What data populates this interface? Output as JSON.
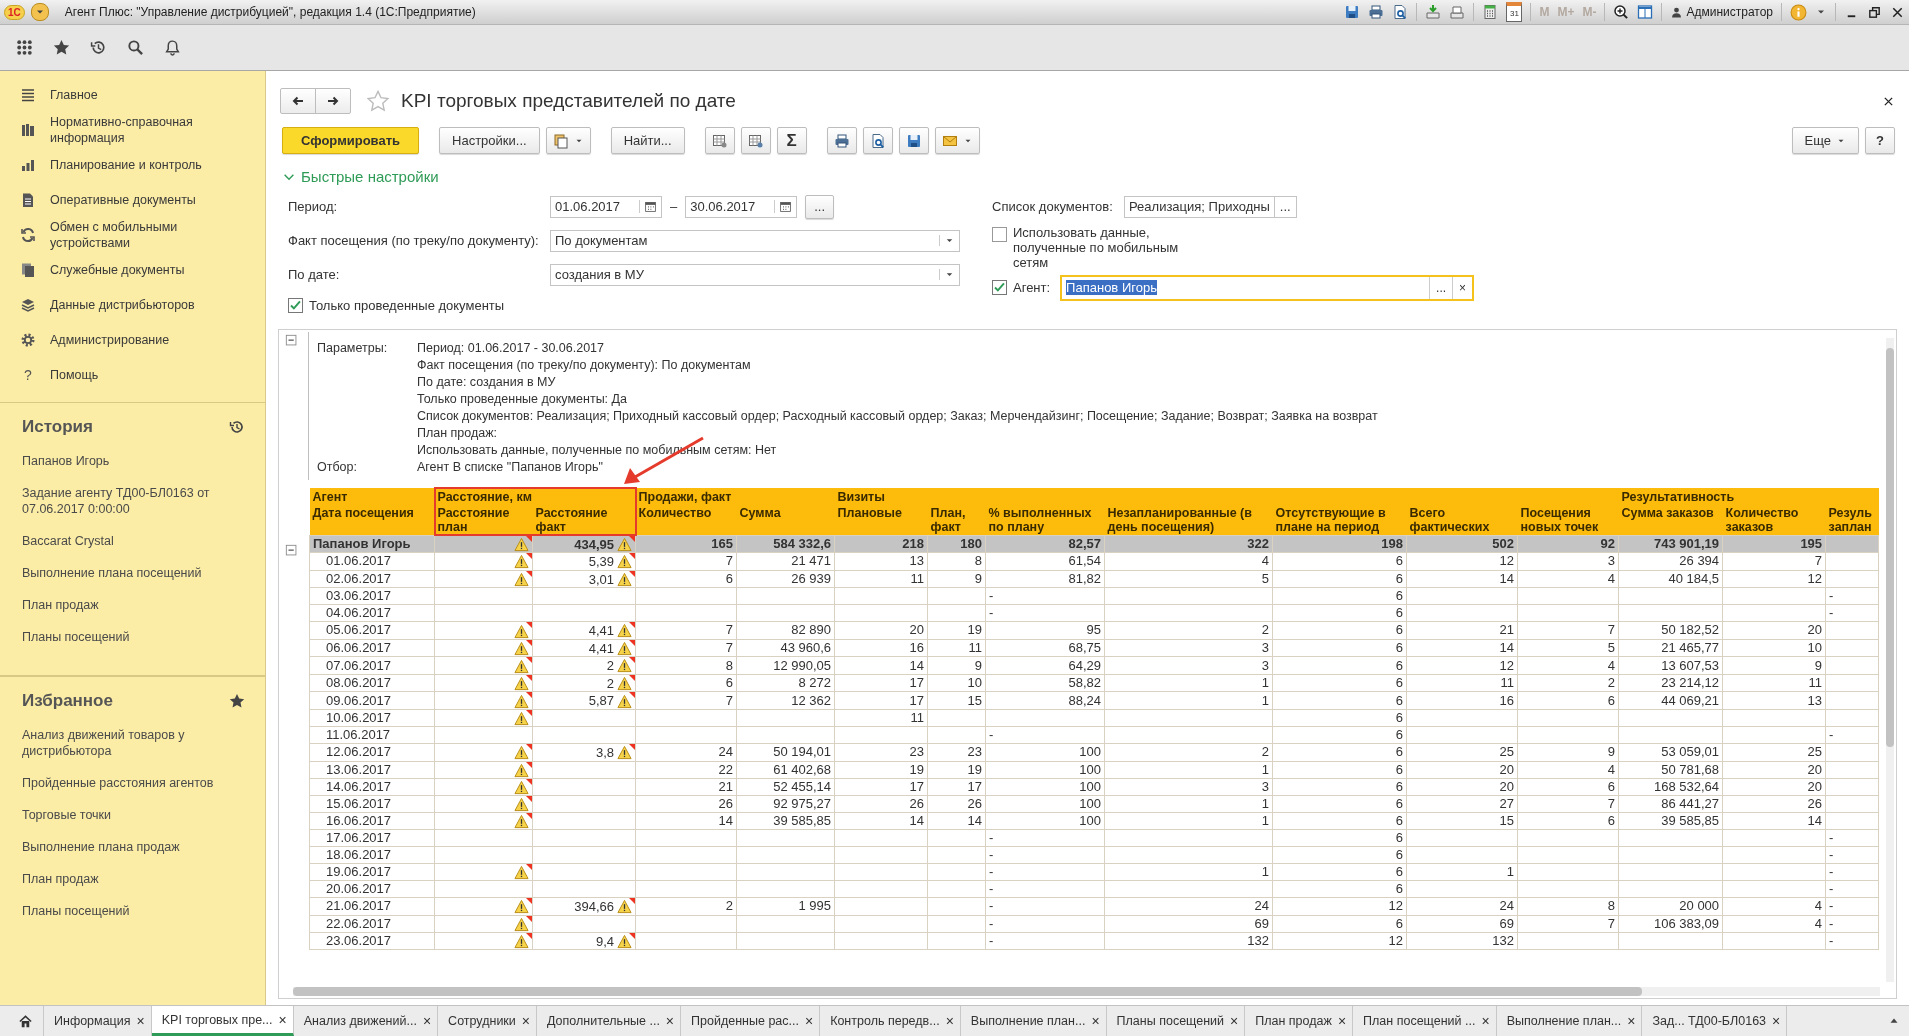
{
  "titlebar": {
    "logo": "1С",
    "title": "Агент Плюс: \"Управление дистрибуцией\", редакция 1.4  (1С:Предприятие)",
    "tools": [
      {
        "kind": "save"
      },
      {
        "kind": "print"
      },
      {
        "kind": "preview"
      },
      {
        "kind": "sep"
      },
      {
        "kind": "import"
      },
      {
        "kind": "export"
      },
      {
        "kind": "sep"
      },
      {
        "kind": "calculator"
      },
      {
        "kind": "calendar",
        "label": "31"
      },
      {
        "kind": "sep"
      },
      {
        "kind": "text",
        "label": "M",
        "disabled": true
      },
      {
        "kind": "text",
        "label": "M+",
        "disabled": true
      },
      {
        "kind": "text",
        "label": "M-",
        "disabled": true
      },
      {
        "kind": "sep"
      },
      {
        "kind": "zoom"
      },
      {
        "kind": "panel"
      },
      {
        "kind": "sep"
      }
    ],
    "user": "Администратор"
  },
  "topbar": [
    {
      "kind": "apps"
    },
    {
      "kind": "star"
    },
    {
      "kind": "history"
    },
    {
      "kind": "search"
    },
    {
      "kind": "bell"
    }
  ],
  "sidebar": {
    "items": [
      {
        "label": "Главное"
      },
      {
        "label": "Нормативно-справочная информация"
      },
      {
        "label": "Планирование и контроль"
      },
      {
        "label": "Оперативные документы"
      },
      {
        "label": "Обмен с мобильными устройствами"
      },
      {
        "label": "Служебные документы"
      },
      {
        "label": "Данные дистрибьюторов"
      },
      {
        "label": "Администрирование"
      },
      {
        "label": "Помощь",
        "glyph": "?"
      }
    ],
    "sections": [
      {
        "title": "История",
        "items": [
          "Папанов Игорь",
          "Задание агенту ТД00-БЛ0163 от 07.06.2017 0:00:00",
          "Baccarat Crystal",
          "Выполнение плана посещений",
          "План продаж",
          "Планы посещений"
        ]
      },
      {
        "title": "Избранное",
        "items": [
          "Анализ движений товаров у дистрибьютора",
          "Пройденные расстояния агентов",
          "Торговые точки",
          "Выполнение плана продаж",
          "План продаж",
          "Планы посещений"
        ]
      }
    ]
  },
  "form": {
    "title": "KPI торговых представителей по дате",
    "toolbar": [
      {
        "kind": "primary",
        "label": "Сформировать"
      },
      {
        "kind": "text",
        "label": "Настройки..."
      },
      {
        "kind": "variants",
        "dropdown": true
      },
      {
        "kind": "text",
        "label": "Найти..."
      },
      {
        "kind": "tablegear"
      },
      {
        "kind": "tablegear2"
      },
      {
        "kind": "glyph",
        "label": "Σ"
      },
      {
        "kind": "print"
      },
      {
        "kind": "preview"
      },
      {
        "kind": "save"
      },
      {
        "kind": "mail",
        "dropdown": true
      }
    ],
    "more_button": "Еще",
    "help_button": "?",
    "quick_settings": {
      "title": "Быстрые настройки",
      "expanded": true,
      "period": {
        "label": "Период:",
        "from": "01.06.2017",
        "dash": "–",
        "to": "30.06.2017",
        "more": "..."
      },
      "visit_fact": {
        "label": "Факт посещения (по треку/по документу):",
        "value": "По документам"
      },
      "by_date": {
        "label": "По дате:",
        "value": "создания в МУ"
      },
      "only_posted": {
        "label": "Только проведенные документы",
        "checked": true
      },
      "doc_list": {
        "label": "Список документов:",
        "value": "Реализация; Приходны",
        "more": "..."
      },
      "mobile_data": {
        "label": "Использовать данные, полученные по мобильным сетям",
        "checked": false
      },
      "agent": {
        "label": "Агент:",
        "checked": true,
        "value": "Папанов Игорь",
        "text_selected": true,
        "focused": true,
        "more": "...",
        "clear": "×"
      }
    }
  },
  "report": {
    "parameters": {
      "label": "Параметры:",
      "lines": [
        "Период: 01.06.2017 - 30.06.2017",
        "Факт посещения (по треку/по документу): По документам",
        "По дате: создания в МУ",
        "Только проведенные документы: Да",
        "Список документов: Реализация; Приходный кассовый ордер; Расходный кассовый ордер; Заказ; Мерчендайзинг; Посещение; Задание; Возврат; Заявка на возврат",
        "План продаж:",
        "Использовать данные, полученные по мобильным сетям: Нет"
      ]
    },
    "filter": {
      "label": "Отбор:",
      "value": "Агент В списке \"Папанов Игорь\""
    },
    "group_headers": [
      "Агент",
      "Расстояние, км",
      "Продажи, факт",
      "Визиты",
      "Результативность"
    ],
    "columns": [
      "Дата посещения",
      "Расстояние план",
      "Расстояние факт",
      "Количество",
      "Сумма",
      "Плановые",
      "План, факт",
      "% выполненных по плану",
      "Незапланированные (в день посещения)",
      "Отсутствующие в плане на период",
      "Всего фактических",
      "Посещения новых точек",
      "Сумма заказов",
      "Количество заказов",
      "Резуль заплан"
    ],
    "rows": [
      {
        "kind": "group",
        "label": "Папанов Игорь",
        "plan_warning": true,
        "fact_warning": true,
        "distance_fact": "434,95",
        "sales_qty": "165",
        "sales_sum": "584 332,6",
        "visits_planned": "218",
        "visits_fact": "180",
        "percent_done": "82,57",
        "unplanned": "322",
        "absent": "198",
        "total_fact": "502",
        "new_points": "92",
        "orders_sum": "743 901,19",
        "orders_qty": "195"
      },
      {
        "kind": "day",
        "label": "01.06.2017",
        "plan_warning": true,
        "fact_warning": true,
        "distance_fact": "5,39",
        "sales_qty": "7",
        "sales_sum": "21 471",
        "visits_planned": "13",
        "visits_fact": "8",
        "percent_done": "61,54",
        "unplanned": "4",
        "absent": "6",
        "total_fact": "12",
        "new_points": "3",
        "orders_sum": "26 394",
        "orders_qty": "7"
      },
      {
        "kind": "day",
        "label": "02.06.2017",
        "plan_warning": true,
        "fact_warning": true,
        "distance_fact": "3,01",
        "sales_qty": "6",
        "sales_sum": "26 939",
        "visits_planned": "11",
        "visits_fact": "9",
        "percent_done": "81,82",
        "unplanned": "5",
        "absent": "6",
        "total_fact": "14",
        "new_points": "4",
        "orders_sum": "40 184,5",
        "orders_qty": "12"
      },
      {
        "kind": "day",
        "label": "03.06.2017",
        "plan_warning": false,
        "fact_warning": false,
        "percent_done": "-",
        "absent": "6",
        "column_15": "-"
      },
      {
        "kind": "day",
        "label": "04.06.2017",
        "plan_warning": false,
        "fact_warning": false,
        "percent_done": "-",
        "absent": "6",
        "column_15": "-"
      },
      {
        "kind": "day",
        "label": "05.06.2017",
        "plan_warning": true,
        "fact_warning": true,
        "distance_fact": "4,41",
        "sales_qty": "7",
        "sales_sum": "82 890",
        "visits_planned": "20",
        "visits_fact": "19",
        "percent_done": "95",
        "unplanned": "2",
        "absent": "6",
        "total_fact": "21",
        "new_points": "7",
        "orders_sum": "50 182,52",
        "orders_qty": "20"
      },
      {
        "kind": "day",
        "label": "06.06.2017",
        "plan_warning": true,
        "fact_warning": true,
        "distance_fact": "4,41",
        "sales_qty": "7",
        "sales_sum": "43 960,6",
        "visits_planned": "16",
        "visits_fact": "11",
        "percent_done": "68,75",
        "unplanned": "3",
        "absent": "6",
        "total_fact": "14",
        "new_points": "5",
        "orders_sum": "21 465,77",
        "orders_qty": "10"
      },
      {
        "kind": "day",
        "label": "07.06.2017",
        "plan_warning": true,
        "fact_warning": true,
        "distance_fact": "2",
        "sales_qty": "8",
        "sales_sum": "12 990,05",
        "visits_planned": "14",
        "visits_fact": "9",
        "percent_done": "64,29",
        "unplanned": "3",
        "absent": "6",
        "total_fact": "12",
        "new_points": "4",
        "orders_sum": "13 607,53",
        "orders_qty": "9"
      },
      {
        "kind": "day",
        "label": "08.06.2017",
        "plan_warning": true,
        "fact_warning": true,
        "distance_fact": "2",
        "sales_qty": "6",
        "sales_sum": "8 272",
        "visits_planned": "17",
        "visits_fact": "10",
        "percent_done": "58,82",
        "unplanned": "1",
        "absent": "6",
        "total_fact": "11",
        "new_points": "2",
        "orders_sum": "23 214,12",
        "orders_qty": "11"
      },
      {
        "kind": "day",
        "label": "09.06.2017",
        "plan_warning": true,
        "fact_warning": true,
        "distance_fact": "5,87",
        "sales_qty": "7",
        "sales_sum": "12 362",
        "visits_planned": "17",
        "visits_fact": "15",
        "percent_done": "88,24",
        "unplanned": "1",
        "absent": "6",
        "total_fact": "16",
        "new_points": "6",
        "orders_sum": "44 069,21",
        "orders_qty": "13"
      },
      {
        "kind": "day",
        "label": "10.06.2017",
        "plan_warning": true,
        "fact_warning": false,
        "visits_planned": "11",
        "absent": "6"
      },
      {
        "kind": "day",
        "label": "11.06.2017",
        "plan_warning": false,
        "fact_warning": false,
        "percent_done": "-",
        "absent": "6",
        "column_15": "-"
      },
      {
        "kind": "day",
        "label": "12.06.2017",
        "plan_warning": true,
        "fact_warning": true,
        "distance_fact": "3,8",
        "sales_qty": "24",
        "sales_sum": "50 194,01",
        "visits_planned": "23",
        "visits_fact": "23",
        "percent_done": "100",
        "unplanned": "2",
        "absent": "6",
        "total_fact": "25",
        "new_points": "9",
        "orders_sum": "53 059,01",
        "orders_qty": "25"
      },
      {
        "kind": "day",
        "label": "13.06.2017",
        "plan_warning": true,
        "fact_warning": false,
        "sales_qty": "22",
        "sales_sum": "61 402,68",
        "visits_planned": "19",
        "visits_fact": "19",
        "percent_done": "100",
        "unplanned": "1",
        "absent": "6",
        "total_fact": "20",
        "new_points": "4",
        "orders_sum": "50 781,68",
        "orders_qty": "20"
      },
      {
        "kind": "day",
        "label": "14.06.2017",
        "plan_warning": true,
        "fact_warning": false,
        "sales_qty": "21",
        "sales_sum": "52 455,14",
        "visits_planned": "17",
        "visits_fact": "17",
        "percent_done": "100",
        "unplanned": "3",
        "absent": "6",
        "total_fact": "20",
        "new_points": "6",
        "orders_sum": "168 532,64",
        "orders_qty": "20"
      },
      {
        "kind": "day",
        "label": "15.06.2017",
        "plan_warning": true,
        "fact_warning": false,
        "sales_qty": "26",
        "sales_sum": "92 975,27",
        "visits_planned": "26",
        "visits_fact": "26",
        "percent_done": "100",
        "unplanned": "1",
        "absent": "6",
        "total_fact": "27",
        "new_points": "7",
        "orders_sum": "86 441,27",
        "orders_qty": "26"
      },
      {
        "kind": "day",
        "label": "16.06.2017",
        "plan_warning": true,
        "fact_warning": false,
        "sales_qty": "14",
        "sales_sum": "39 585,85",
        "visits_planned": "14",
        "visits_fact": "14",
        "percent_done": "100",
        "unplanned": "1",
        "absent": "6",
        "total_fact": "15",
        "new_points": "6",
        "orders_sum": "39 585,85",
        "orders_qty": "14"
      },
      {
        "kind": "day",
        "label": "17.06.2017",
        "plan_warning": false,
        "fact_warning": false,
        "percent_done": "-",
        "absent": "6",
        "column_15": "-"
      },
      {
        "kind": "day",
        "label": "18.06.2017",
        "plan_warning": false,
        "fact_warning": false,
        "percent_done": "-",
        "absent": "6",
        "column_15": "-"
      },
      {
        "kind": "day",
        "label": "19.06.2017",
        "plan_warning": true,
        "fact_warning": false,
        "percent_done": "-",
        "unplanned": "1",
        "absent": "6",
        "total_fact": "1",
        "column_15": "-"
      },
      {
        "kind": "day",
        "label": "20.06.2017",
        "plan_warning": false,
        "fact_warning": false,
        "percent_done": "-",
        "absent": "6",
        "column_15": "-"
      },
      {
        "kind": "day",
        "label": "21.06.2017",
        "plan_warning": true,
        "fact_warning": true,
        "distance_fact": "394,66",
        "sales_qty": "2",
        "sales_sum": "1 995",
        "percent_done": "-",
        "unplanned": "24",
        "absent": "12",
        "total_fact": "24",
        "new_points": "8",
        "orders_sum": "20 000",
        "orders_qty": "4",
        "column_15": "-"
      },
      {
        "kind": "day",
        "label": "22.06.2017",
        "plan_warning": true,
        "fact_warning": false,
        "percent_done": "-",
        "unplanned": "69",
        "absent": "6",
        "total_fact": "69",
        "new_points": "7",
        "orders_sum": "106 383,09",
        "orders_qty": "4",
        "column_15": "-"
      },
      {
        "kind": "day",
        "label": "23.06.2017",
        "plan_warning": true,
        "fact_warning": true,
        "distance_fact": "9,4",
        "percent_done": "-",
        "unplanned": "132",
        "absent": "12",
        "total_fact": "132",
        "column_15": "-"
      }
    ]
  },
  "tabs": [
    {
      "label": "Информация",
      "selected": false
    },
    {
      "label": "KPI торговых пре...",
      "selected": true
    },
    {
      "label": "Анализ движений...",
      "selected": false
    },
    {
      "label": "Сотрудники",
      "selected": false
    },
    {
      "label": "Дополнительные ...",
      "selected": false
    },
    {
      "label": "Пройденные рас...",
      "selected": false
    },
    {
      "label": "Контроль передв...",
      "selected": false
    },
    {
      "label": "Выполнение план...",
      "selected": false
    },
    {
      "label": "Планы посещений",
      "selected": false
    },
    {
      "label": "План продаж",
      "selected": false
    },
    {
      "label": "План посещений ...",
      "selected": false
    },
    {
      "label": "Выполнение план...",
      "selected": false
    },
    {
      "label": "Зад... ТД00-БЛ0163",
      "selected": false
    }
  ],
  "tab_close": "×"
}
